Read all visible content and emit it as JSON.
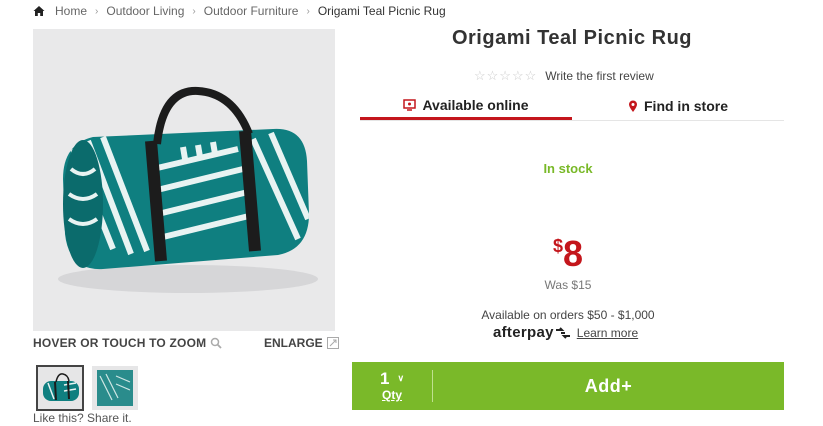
{
  "breadcrumb": {
    "items": [
      "Home",
      "Outdoor Living",
      "Outdoor Furniture"
    ],
    "current": "Origami Teal Picnic Rug"
  },
  "gallery": {
    "zoom_label": "HOVER OR TOUCH TO ZOOM",
    "enlarge_label": "ENLARGE",
    "share_label": "Like this? Share it."
  },
  "product": {
    "title": "Origami Teal Picnic Rug",
    "review_link": "Write the first review",
    "rating_stars": 0,
    "tabs": [
      {
        "label": "Available online",
        "icon": "monitor-icon",
        "active": true
      },
      {
        "label": "Find in store",
        "icon": "map-pin-icon",
        "active": false
      }
    ],
    "stock_status": "In stock",
    "price": {
      "currency": "$",
      "amount": "8",
      "was": "Was $15"
    },
    "afterpay": {
      "availability": "Available on orders $50 - $1,000",
      "brand": "afterpay",
      "learn_more": "Learn more"
    },
    "cart": {
      "qty_value": "1",
      "qty_label": "Qty",
      "add_label": "Add+"
    }
  },
  "colors": {
    "accent_red": "#c4161c",
    "add_green": "#7ab929",
    "stock_green": "#79b928",
    "teal": "#0f7f80"
  }
}
